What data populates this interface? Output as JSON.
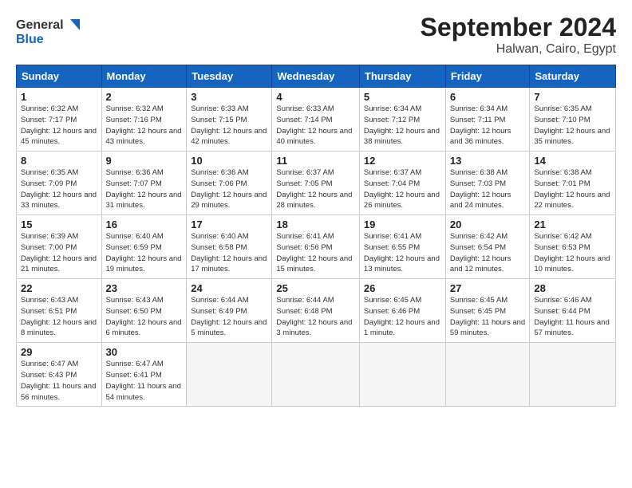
{
  "header": {
    "logo_general": "General",
    "logo_blue": "Blue",
    "title": "September 2024",
    "subtitle": "Halwan, Cairo, Egypt"
  },
  "days_of_week": [
    "Sunday",
    "Monday",
    "Tuesday",
    "Wednesday",
    "Thursday",
    "Friday",
    "Saturday"
  ],
  "weeks": [
    [
      {
        "day": 1,
        "sunrise": "6:32 AM",
        "sunset": "7:17 PM",
        "daylight": "12 hours and 45 minutes."
      },
      {
        "day": 2,
        "sunrise": "6:32 AM",
        "sunset": "7:16 PM",
        "daylight": "12 hours and 43 minutes."
      },
      {
        "day": 3,
        "sunrise": "6:33 AM",
        "sunset": "7:15 PM",
        "daylight": "12 hours and 42 minutes."
      },
      {
        "day": 4,
        "sunrise": "6:33 AM",
        "sunset": "7:14 PM",
        "daylight": "12 hours and 40 minutes."
      },
      {
        "day": 5,
        "sunrise": "6:34 AM",
        "sunset": "7:12 PM",
        "daylight": "12 hours and 38 minutes."
      },
      {
        "day": 6,
        "sunrise": "6:34 AM",
        "sunset": "7:11 PM",
        "daylight": "12 hours and 36 minutes."
      },
      {
        "day": 7,
        "sunrise": "6:35 AM",
        "sunset": "7:10 PM",
        "daylight": "12 hours and 35 minutes."
      }
    ],
    [
      {
        "day": 8,
        "sunrise": "6:35 AM",
        "sunset": "7:09 PM",
        "daylight": "12 hours and 33 minutes."
      },
      {
        "day": 9,
        "sunrise": "6:36 AM",
        "sunset": "7:07 PM",
        "daylight": "12 hours and 31 minutes."
      },
      {
        "day": 10,
        "sunrise": "6:36 AM",
        "sunset": "7:06 PM",
        "daylight": "12 hours and 29 minutes."
      },
      {
        "day": 11,
        "sunrise": "6:37 AM",
        "sunset": "7:05 PM",
        "daylight": "12 hours and 28 minutes."
      },
      {
        "day": 12,
        "sunrise": "6:37 AM",
        "sunset": "7:04 PM",
        "daylight": "12 hours and 26 minutes."
      },
      {
        "day": 13,
        "sunrise": "6:38 AM",
        "sunset": "7:03 PM",
        "daylight": "12 hours and 24 minutes."
      },
      {
        "day": 14,
        "sunrise": "6:38 AM",
        "sunset": "7:01 PM",
        "daylight": "12 hours and 22 minutes."
      }
    ],
    [
      {
        "day": 15,
        "sunrise": "6:39 AM",
        "sunset": "7:00 PM",
        "daylight": "12 hours and 21 minutes."
      },
      {
        "day": 16,
        "sunrise": "6:40 AM",
        "sunset": "6:59 PM",
        "daylight": "12 hours and 19 minutes."
      },
      {
        "day": 17,
        "sunrise": "6:40 AM",
        "sunset": "6:58 PM",
        "daylight": "12 hours and 17 minutes."
      },
      {
        "day": 18,
        "sunrise": "6:41 AM",
        "sunset": "6:56 PM",
        "daylight": "12 hours and 15 minutes."
      },
      {
        "day": 19,
        "sunrise": "6:41 AM",
        "sunset": "6:55 PM",
        "daylight": "12 hours and 13 minutes."
      },
      {
        "day": 20,
        "sunrise": "6:42 AM",
        "sunset": "6:54 PM",
        "daylight": "12 hours and 12 minutes."
      },
      {
        "day": 21,
        "sunrise": "6:42 AM",
        "sunset": "6:53 PM",
        "daylight": "12 hours and 10 minutes."
      }
    ],
    [
      {
        "day": 22,
        "sunrise": "6:43 AM",
        "sunset": "6:51 PM",
        "daylight": "12 hours and 8 minutes."
      },
      {
        "day": 23,
        "sunrise": "6:43 AM",
        "sunset": "6:50 PM",
        "daylight": "12 hours and 6 minutes."
      },
      {
        "day": 24,
        "sunrise": "6:44 AM",
        "sunset": "6:49 PM",
        "daylight": "12 hours and 5 minutes."
      },
      {
        "day": 25,
        "sunrise": "6:44 AM",
        "sunset": "6:48 PM",
        "daylight": "12 hours and 3 minutes."
      },
      {
        "day": 26,
        "sunrise": "6:45 AM",
        "sunset": "6:46 PM",
        "daylight": "12 hours and 1 minute."
      },
      {
        "day": 27,
        "sunrise": "6:45 AM",
        "sunset": "6:45 PM",
        "daylight": "11 hours and 59 minutes."
      },
      {
        "day": 28,
        "sunrise": "6:46 AM",
        "sunset": "6:44 PM",
        "daylight": "11 hours and 57 minutes."
      }
    ],
    [
      {
        "day": 29,
        "sunrise": "6:47 AM",
        "sunset": "6:43 PM",
        "daylight": "11 hours and 56 minutes."
      },
      {
        "day": 30,
        "sunrise": "6:47 AM",
        "sunset": "6:41 PM",
        "daylight": "11 hours and 54 minutes."
      },
      null,
      null,
      null,
      null,
      null
    ]
  ]
}
